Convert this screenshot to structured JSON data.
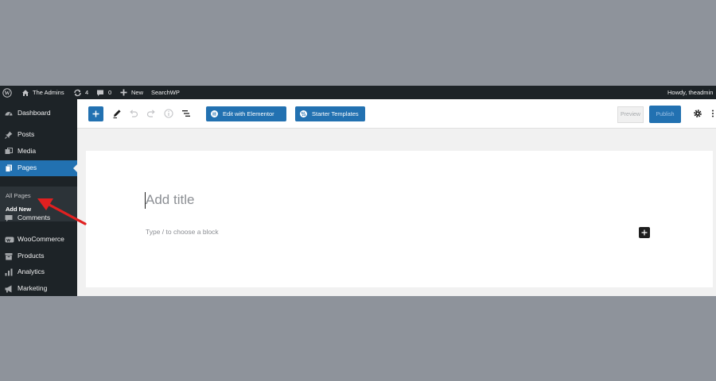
{
  "admin_bar": {
    "site_name": "The Admins",
    "updates_count": "4",
    "comments_count": "0",
    "new_label": "New",
    "searchwp_label": "SearchWP",
    "howdy": "Howdy, theadmin"
  },
  "sidebar": {
    "items": [
      {
        "label": "Dashboard",
        "icon": "dashboard-icon"
      },
      {
        "label": "Posts",
        "icon": "pin-icon"
      },
      {
        "label": "Media",
        "icon": "media-icon"
      },
      {
        "label": "Pages",
        "icon": "pages-icon",
        "active": true
      },
      {
        "label": "Comments",
        "icon": "comment-icon"
      },
      {
        "label": "WooCommerce",
        "icon": "woocommerce-icon"
      },
      {
        "label": "Products",
        "icon": "archive-icon"
      },
      {
        "label": "Analytics",
        "icon": "bar-chart-icon"
      },
      {
        "label": "Marketing",
        "icon": "megaphone-icon"
      }
    ],
    "submenu": [
      {
        "label": "All Pages"
      },
      {
        "label": "Add New",
        "current": true
      }
    ]
  },
  "toolbar": {
    "elementor_label": "Edit with Elementor",
    "starter_templates_label": "Starter Templates",
    "preview_label": "Preview",
    "publish_label": "Publish"
  },
  "editor": {
    "title_placeholder": "Add title",
    "block_placeholder": "Type / to choose a block"
  },
  "colors": {
    "accent": "#2271b1",
    "admin_dark": "#1d2327",
    "annotation_arrow": "#e02020"
  }
}
